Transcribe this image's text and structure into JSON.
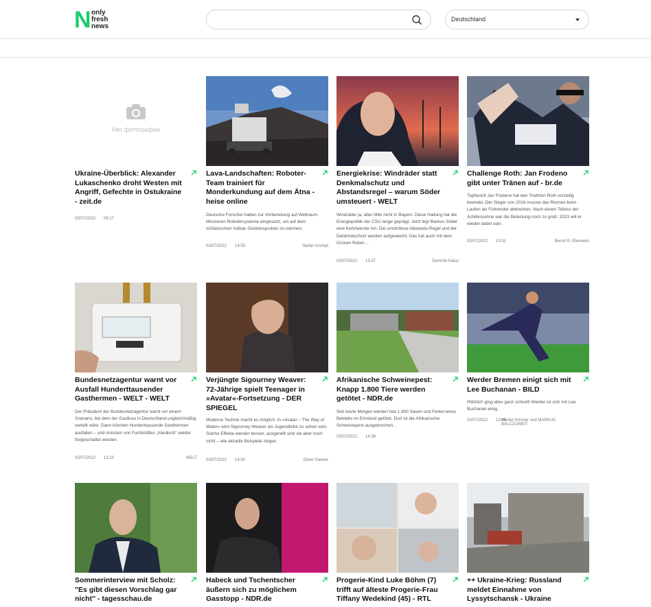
{
  "header": {
    "logo_lines": [
      "only",
      "fresh",
      "news"
    ],
    "logo_letter": "N",
    "search_placeholder": "",
    "country": "Deutschland"
  },
  "no_photo_label": "Нет фотографии",
  "cards": [
    {
      "title": "Ukraine-Überblick: Alexander Lukaschenko droht Westen mit Angriff, Gefechte in Ostukraine - zeit.de",
      "desc": "",
      "date": "03/07/2022",
      "time": "08:17",
      "author": ""
    },
    {
      "title": "Lava-Landschaften: Roboter-Team trainiert für Monderkundung auf dem Ätna - heise online",
      "desc": "Deutsche Forscher haben zur Vorbereitung auf Weltraum-Missionen Robotersysteme eingesetzt, um auf dem sizilianischen Vulkan Gesteinsproben zu nehmen.",
      "date": "03/07/2022",
      "time": "14:55",
      "author": "Stefan Krempl"
    },
    {
      "title": "Energiekrise: Windräder statt Denkmalschutz und Abstandsregel – warum Söder umsteuert - WELT",
      "desc": "Windräder ja, aber bitte nicht in Bayern: Diese Haltung hat die Energiepolitik der CSU lange geprägt. Jetzt legt Markus Söder eine Kehrtwende hin. Die umstrittene Abstands-Regel und der Denkmalschutz werden aufgeweicht. Das hat auch mit dem Grünen Rober…",
      "date": "03/07/2022",
      "time": "13:37",
      "author": "Dominik Kalus"
    },
    {
      "title": "Challenge Roth: Jan Frodeno gibt unter Tränen auf - br.de",
      "desc": "Topfavorit Jan Frodeno hat den Triathlon Roth vorzeitig beendet. Der Sieger von 2016 musste das Rennen beim Laufen als Führender abbrechen. Nach einem Teilriss der Achillessehne war die Belastung noch zu groß. 2023 will er wieder dabei sein.",
      "date": "03/07/2022",
      "time": "13:31",
      "author": "Bernd R. Eberwein"
    },
    {
      "title": "Bundesnetzagentur warnt vor Ausfall Hunderttausender Gasthermen - WELT - WELT",
      "desc": "Der Präsident der Bundesnetzagentur warnt vor einem Szenario, bei dem der Gasfluss in Deutschland ungleichmäßig verteilt wäre: Dann könnten Hunderttausende Gasthermen ausfallen – und müssten von Fachkräften „händisch“ wieder freigeschaltet werden.",
      "date": "03/07/2022",
      "time": "13:10",
      "author": "WELT"
    },
    {
      "title": "Verjüngte Sigourney Weaver: 72-Jährige spielt Teenager in »Avatar«-Fortsetzung - DER SPIEGEL",
      "desc": "Moderne Technik macht es möglich: In »Avatar – The Way of Water« wird Sigourney Weaver als Jugendliche zu sehen sein. Solche Effekte werden besser, ausgereift sind sie aber noch nicht – wie aktuelle Beispiele zeigen.",
      "date": "03/07/2022",
      "time": "14:50",
      "author": "Oliver Kaever"
    },
    {
      "title": "Afrikanische Schweinepest: Knapp 1.800 Tiere werden getötet - NDR.de",
      "desc": "Seit heute Morgen werden fast 1.800 Sauen und Ferkel eines Betriebs im Emsland getötet. Dort ist die Afrikanische Schweinepest ausgebrochen.",
      "date": "03/07/2022",
      "time": "14:38",
      "author": ""
    },
    {
      "title": "Werder Bremen einigt sich mit Lee Buchanan - BILD",
      "desc": "Plötzlich ging alles ganz schnell! Werder ist sich mit Lee Buchanan einig.",
      "date": "03/07/2022",
      "time": "13:48",
      "author": "Michel Schröer und MARKUS BALCZUWEIT"
    },
    {
      "title": "Sommerinterview mit Scholz: \"Es gibt diesen Vorschlag gar nicht\" - tagesschau.de",
      "desc": "",
      "date": "",
      "time": "",
      "author": ""
    },
    {
      "title": "Habeck und Tschentscher äußern sich zu möglichem Gasstopp - NDR.de",
      "desc": "",
      "date": "",
      "time": "",
      "author": ""
    },
    {
      "title": "Progerie-Kind Luke Böhm (7) trifft auf älteste Progerie-Frau Tiffany Wedekind (45) - RTL",
      "desc": "",
      "date": "",
      "time": "",
      "author": ""
    },
    {
      "title": "++ Ukraine-Krieg: Russland meldet Einnahme von Lyssytschansk - Ukraine",
      "desc": "",
      "date": "",
      "time": "",
      "author": ""
    }
  ],
  "colors": {
    "accent": "#1ecb6f",
    "border": "#e5e5e5"
  }
}
